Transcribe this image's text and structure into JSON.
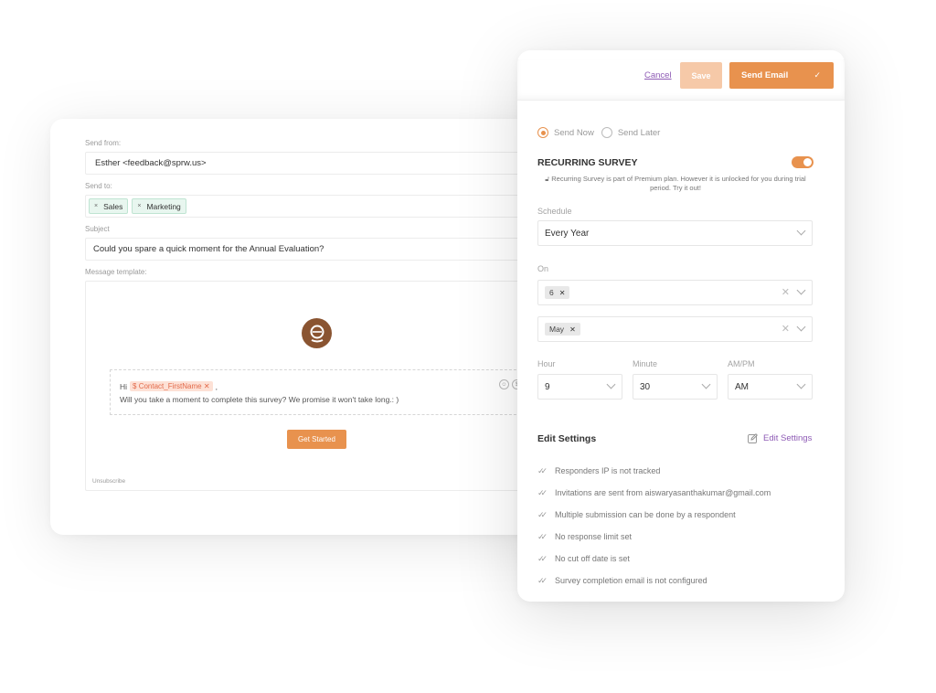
{
  "composer": {
    "send_from_label": "Send from:",
    "send_from_value": "Esther <feedback@sprw.us>",
    "send_to_label": "Send to:",
    "recipients": [
      "Sales",
      "Marketing"
    ],
    "subject_label": "Subject",
    "subject_value": "Could you spare a quick moment for the Annual Evaluation?",
    "message_template_label": "Message template:",
    "template_link_partial": "T",
    "message": {
      "greeting": "Hi",
      "variable": "$ Contact_FirstName",
      "greeting_suffix": ",",
      "body": "Will you take a moment to complete this survey? We promise it won't take long.: )"
    },
    "cta_label": "Get Started",
    "unsubscribe": "Unsubscribe"
  },
  "panel": {
    "cancel_label": "Cancel",
    "save_label": "Save",
    "send_email_label": "Send Email",
    "send_options": [
      {
        "label": "Send Now",
        "selected": true
      },
      {
        "label": "Send Later",
        "selected": false
      }
    ],
    "recurring_title": "RECURRING SURVEY",
    "recurring_enabled": true,
    "recurring_note": "Recurring Survey is part of Premium plan. However it is unlocked for you during trial period. Try it out!",
    "schedule_label": "Schedule",
    "schedule_value": "Every Year",
    "on_label": "On",
    "on_day": "6",
    "on_month": "May",
    "hour_label": "Hour",
    "hour_value": "9",
    "minute_label": "Minute",
    "minute_value": "30",
    "ampm_label": "AM/PM",
    "ampm_value": "AM",
    "edit_settings_title": "Edit Settings",
    "edit_settings_link": "Edit Settings",
    "settings": [
      "Responders IP is not tracked",
      "Invitations are sent from aiswaryasanthakumar@gmail.com",
      "Multiple submission can be done by a respondent",
      "No response limit set",
      "No cut off date is set",
      "Survey completion email is not configured"
    ]
  },
  "colors": {
    "accent": "#e8924e",
    "accent_light": "#f6c9a8",
    "link": "#8e5bb5",
    "logo": "#8a5431"
  }
}
